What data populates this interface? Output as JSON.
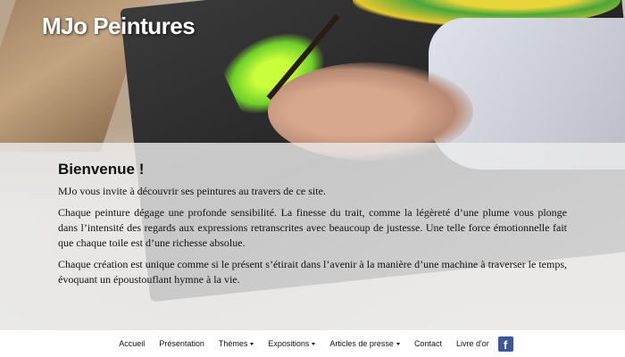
{
  "header": {
    "site_title": "MJo Peintures"
  },
  "main": {
    "heading": "Bienvenue !",
    "paragraphs": [
      "MJo vous invite à découvrir ses peintures au travers de ce site.",
      "Chaque peinture dégage une profonde sensibilité. La finesse du trait, comme la légèreté d’une plume vous plonge dans l’intensité des regards aux expressions retranscrites avec beaucoup de justesse. Une telle force émotionnelle fait que chaque toile est d’une richesse absolue.",
      "Chaque création est unique comme si le présent s’étirait dans l’avenir à la manière d’une machine à traverser le temps, évoquant un époustouflant hymne à la vie."
    ]
  },
  "nav": {
    "items": [
      {
        "label": "Accueil",
        "dropdown": false
      },
      {
        "label": "Présentation",
        "dropdown": false
      },
      {
        "label": "Thèmes",
        "dropdown": true
      },
      {
        "label": "Expositions",
        "dropdown": true
      },
      {
        "label": "Articles de presse",
        "dropdown": true
      },
      {
        "label": "Contact",
        "dropdown": false
      },
      {
        "label": "Livre d'or",
        "dropdown": false
      }
    ],
    "social_icon": "f"
  },
  "colors": {
    "facebook": "#3b5998",
    "title_text": "#ffffff"
  }
}
